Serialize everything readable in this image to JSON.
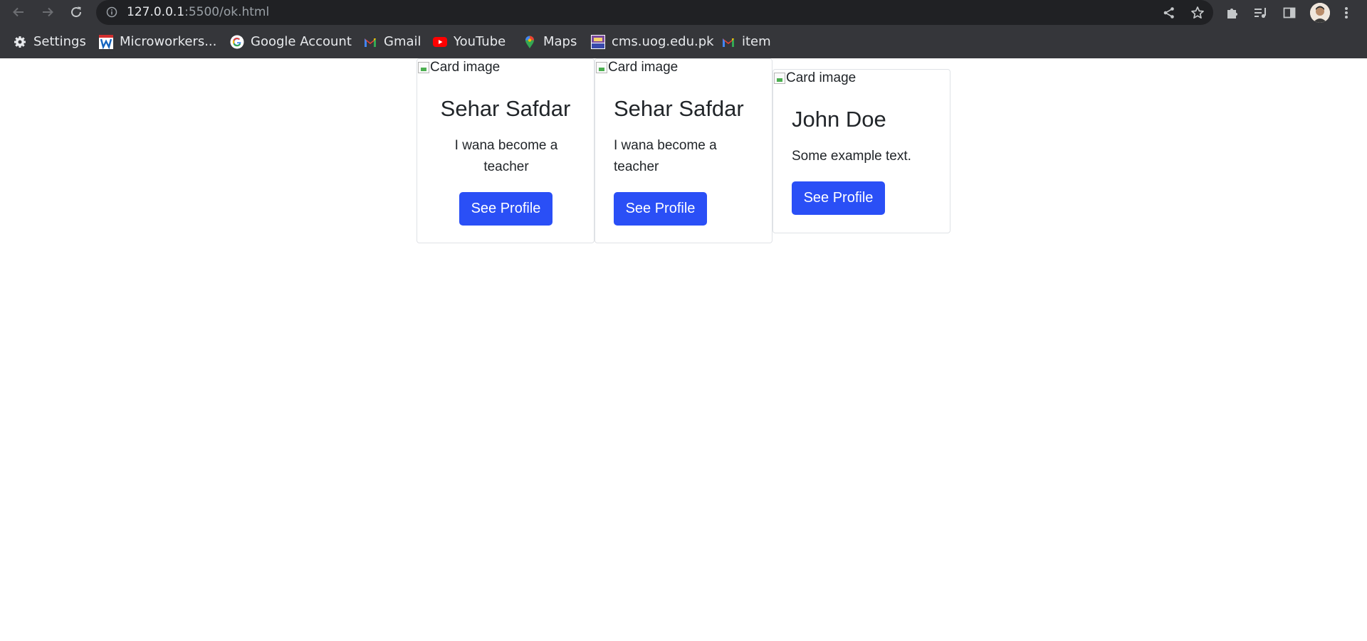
{
  "browser": {
    "url_host": "127.0.0.1",
    "url_path": ":5500/ok.html",
    "bookmarks": [
      {
        "label": "Settings",
        "icon": "gear-icon"
      },
      {
        "label": "Microworkers...",
        "icon": "microworkers-icon"
      },
      {
        "label": "Google Account",
        "icon": "google-icon"
      },
      {
        "label": "Gmail",
        "icon": "gmail-icon"
      },
      {
        "label": "YouTube",
        "icon": "youtube-icon"
      },
      {
        "label": "Maps",
        "icon": "maps-icon"
      },
      {
        "label": "cms.uog.edu.pk",
        "icon": "uog-icon"
      },
      {
        "label": "item",
        "icon": "gmail-icon"
      }
    ]
  },
  "cards": [
    {
      "img_alt": "Card image",
      "title": "Sehar Safdar",
      "text": "I wana become a teacher",
      "button": "See Profile",
      "align": "center"
    },
    {
      "img_alt": "Card image",
      "title": "Sehar Safdar",
      "text": "I wana become a teacher",
      "button": "See Profile",
      "align": "left"
    },
    {
      "img_alt": "Card image",
      "title": "John Doe",
      "text": "Some example text.",
      "button": "See Profile",
      "align": "left"
    }
  ],
  "colors": {
    "chrome_bg": "#35363a",
    "omnibox_bg": "#202124",
    "button_primary": "#2a4ff6",
    "card_border": "#dfe2e6",
    "text": "#212529"
  }
}
